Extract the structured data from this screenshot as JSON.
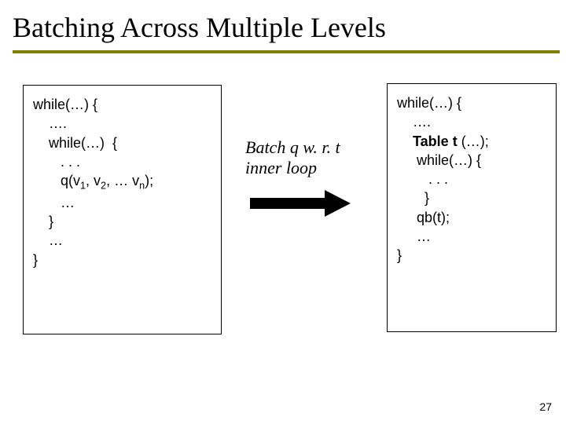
{
  "title": "Batching Across Multiple Levels",
  "middle": {
    "line1": "Batch q w. r. t",
    "line2": "inner loop"
  },
  "left": {
    "l0": "while(…) {",
    "l1": "    ….",
    "l2": "    while(…)  {",
    "l3": "       . . .",
    "l4_a": "       q(v",
    "l4_s1": "1",
    "l4_b": ", v",
    "l4_s2": "2",
    "l4_c": ", … v",
    "l4_s3": "n",
    "l4_d": ");",
    "l5": "       …",
    "l6": "    }",
    "l7": "    …",
    "l8": "}"
  },
  "right": {
    "r0": "while(…) {",
    "r1": "    ….",
    "r2_a": "    ",
    "r2_b": "Table t ",
    "r2_c": "(…);",
    "r3": "     while(…) {",
    "r4": "        . . .",
    "r5": "       }",
    "r6": "     qb(t);",
    "r7": "     …",
    "r8": "}"
  },
  "page": "27"
}
